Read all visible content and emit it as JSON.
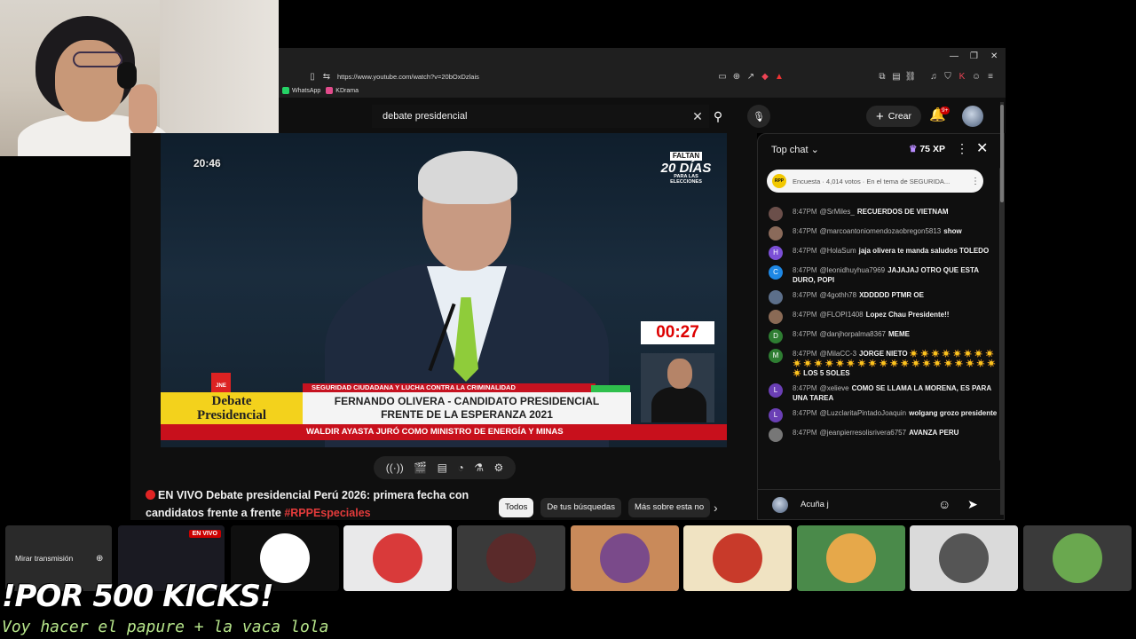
{
  "browser": {
    "url": "https://www.youtube.com/watch?v=20bOxDzlais",
    "bookmarks": [
      {
        "label": "WhatsApp",
        "color": "#25d366"
      },
      {
        "label": "KDrama",
        "color": "#e24b8b"
      }
    ]
  },
  "youtube": {
    "search_query": "debate presidencial",
    "create_label": "Crear",
    "notification_count": "9+"
  },
  "video": {
    "time_overlay": "20:46",
    "faltan_top": "FALTAN",
    "faltan_days": "20 DÍAS",
    "faltan_bottom": "PARA LAS ELECCIONES",
    "countdown": "00:27",
    "topic": "SEGURIDAD CIUDADANA Y LUCHA CONTRA LA CRIMINALIDAD",
    "debate_label_line1": "Debate",
    "debate_label_line2": "Presidencial",
    "candidate_line1": "FERNANDO OLIVERA -  CANDIDATO PRESIDENCIAL",
    "candidate_line2": "FRENTE DE LA ESPERANZA 2021",
    "ticker": "WALDIR AYASTA JURÓ COMO MINISTRO DE ENERGÍA Y MINAS",
    "jne_label": "JNE",
    "title_main": "EN VIVO Debate presidencial Perú 2026: primera fecha con candidatos frente a frente",
    "title_hashtag": "#RPPEspeciales"
  },
  "chips": [
    {
      "label": "Todos",
      "active": true
    },
    {
      "label": "De tus búsquedas",
      "active": false
    },
    {
      "label": "Más sobre esta no",
      "active": false
    }
  ],
  "chat": {
    "title": "Top chat",
    "xp": "75 XP",
    "poll_logo": "RPP",
    "poll_text": "Encuesta · 4,014 votos · En el tema de SEGURIDA...",
    "input_value": "Acuña j",
    "messages": [
      {
        "time": "8:47PM",
        "user": "@SrMiles_",
        "text": "RECUERDOS DE VIETNAM",
        "avatar": "",
        "color": "#6b4f4a"
      },
      {
        "time": "8:47PM",
        "user": "@marcoantoniomendozaobregon5813",
        "text": "show",
        "avatar": "",
        "color": "#8a6a5a"
      },
      {
        "time": "8:47PM",
        "user": "@HolaSum",
        "text": "jaja olivera te manda saludos TOLEDO",
        "avatar": "H",
        "color": "#7b4fd6"
      },
      {
        "time": "8:47PM",
        "user": "@leonidhuyhua7969",
        "text": "JAJAJAJ OTRO QUE ESTA DURO, POPI",
        "avatar": "C",
        "color": "#1e88e5"
      },
      {
        "time": "8:47PM",
        "user": "@4gothh78",
        "text": "XDDDDD PTMR OE",
        "avatar": "",
        "color": "#5c6f8a"
      },
      {
        "time": "8:47PM",
        "user": "@FLOPI1408",
        "text": "Lopez Chau Presidente!!",
        "avatar": "",
        "color": "#8a6a55"
      },
      {
        "time": "8:47PM",
        "user": "@danjhorpalma8367",
        "text": "MEME",
        "avatar": "D",
        "color": "#2e7d32"
      },
      {
        "time": "8:47PM",
        "user": "@MilaCC-3",
        "text": "JORGE NIETO ☀️ ☀️ ☀️ ☀️ ☀️ ☀️ ☀️ ☀️ ☀️ ☀️ ☀️ ☀️ ☀️ ☀️ ☀️ ☀️ ☀️ ☀️ ☀️ ☀️ ☀️ ☀️ ☀️ ☀️ ☀️ ☀️ ☀️ ☀️ LOS 5 SOLES",
        "avatar": "M",
        "color": "#2e7d32"
      },
      {
        "time": "8:47PM",
        "user": "@xelieve",
        "text": "COMO SE LLAMA LA MORENA, ES PARA UNA TAREA",
        "avatar": "L",
        "color": "#6a3fb5"
      },
      {
        "time": "8:47PM",
        "user": "@LuzclaritaPintadoJoaquin",
        "text": "wolgang grozo presidente",
        "avatar": "L",
        "color": "#6a3fb5"
      },
      {
        "time": "8:47PM",
        "user": "@jeanpierresolisrivera6757",
        "text": "AVANZA PERU",
        "avatar": "",
        "color": "#777"
      }
    ]
  },
  "strip": {
    "watch_label": "Mirar transmisión",
    "live_badge": "EN VIVO",
    "tiles": [
      {
        "bg": "#0f0f0f",
        "circle": "#ffffff"
      },
      {
        "bg": "#e9e9ea",
        "circle": "#d93a3a"
      },
      {
        "bg": "#3a3a3a",
        "circle": "#5a2a2a"
      },
      {
        "bg": "#c98a5a",
        "circle": "#7a4a8a"
      },
      {
        "bg": "#f0e3c2",
        "circle": "#c83a2a"
      },
      {
        "bg": "#4a8a4a",
        "circle": "#e6a84a"
      },
      {
        "bg": "#dadada",
        "circle": "#555555"
      },
      {
        "bg": "#3a3a3a",
        "circle": "#6aa84f"
      }
    ]
  },
  "overlay": {
    "kicks": "!POR 500 KICKS!",
    "subtitle": "Voy hacer el papure + la vaca lola"
  }
}
